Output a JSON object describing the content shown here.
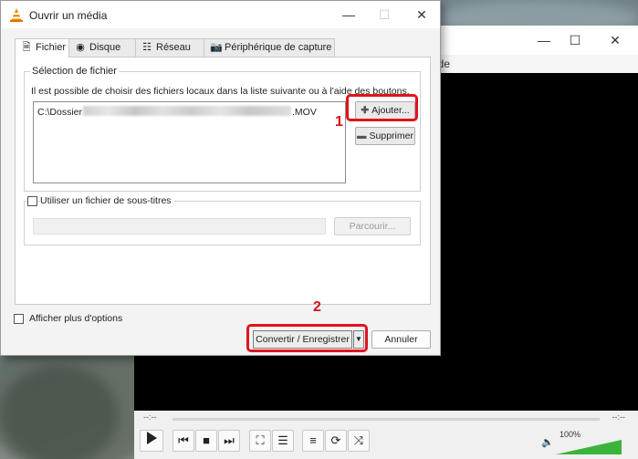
{
  "dialog": {
    "title": "Ouvrir un média",
    "tabs": [
      {
        "label": "Fichier",
        "icon": "file-icon",
        "active": true
      },
      {
        "label": "Disque",
        "icon": "disc-icon",
        "active": false
      },
      {
        "label": "Réseau",
        "icon": "network-icon",
        "active": false
      },
      {
        "label": "Périphérique de capture",
        "icon": "capture-device-icon",
        "active": false
      }
    ],
    "file_selection": {
      "label": "Sélection de fichier",
      "description": "Il est possible de choisir des fichiers locaux dans la liste suivante ou à l'aide des boutons.",
      "file_prefix": "C:\\Dossier",
      "file_suffix": ".MOV",
      "add_label": "Ajouter...",
      "remove_label": "Supprimer"
    },
    "subtitles": {
      "checkbox_label": "Utiliser un fichier de sous-titres",
      "checked": false,
      "browse_label": "Parcourir..."
    },
    "more_options_label": "Afficher plus d'options",
    "more_options_checked": false,
    "convert_label": "Convertir / Enregistrer",
    "cancel_label": "Annuler"
  },
  "annotations": {
    "step1": "1",
    "step2": "2",
    "highlight_color": "#e0141c"
  },
  "vlc": {
    "menu_fragment": "ide",
    "time_elapsed": "--:--",
    "time_total": "--:--",
    "volume_text": "100%",
    "volume_level": 1.0,
    "accent": "#3cb43c"
  }
}
